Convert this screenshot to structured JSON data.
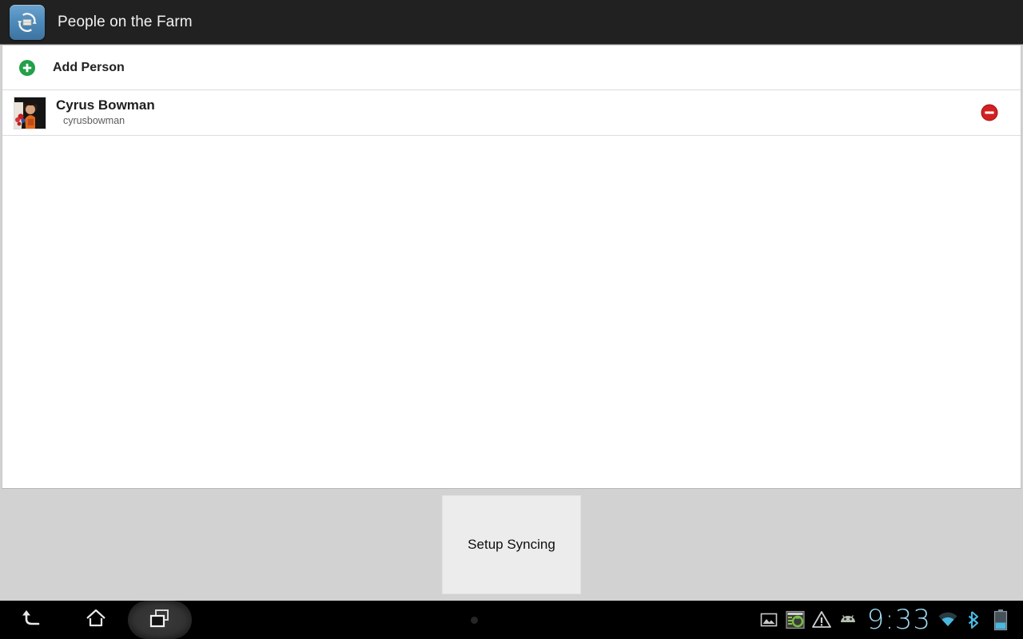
{
  "action_bar": {
    "app_icon_name": "sync-app-icon",
    "title": "People on the Farm"
  },
  "list": {
    "add_row": {
      "icon": "add-circle-icon",
      "label": "Add Person",
      "icon_color": "#22a04a"
    },
    "people": [
      {
        "avatar": "person-photo-avatar",
        "name": "Cyrus Bowman",
        "handle": "cyrusbowman",
        "remove_icon": "remove-circle-icon",
        "remove_color": "#d32020"
      }
    ]
  },
  "setup": {
    "button_label": "Setup Syncing"
  },
  "navbar": {
    "back_icon": "back-arrow-icon",
    "home_icon": "home-icon",
    "recents_icon": "recent-apps-icon",
    "menu_dot_icon": "menu-dot-icon",
    "status": {
      "gallery_icon": "image-icon",
      "screenshot_icon": "screenshot-sync-icon",
      "warning_icon": "warning-triangle-icon",
      "android_icon": "android-head-icon",
      "clock": "9:33",
      "wifi_icon": "wifi-icon",
      "bluetooth_icon": "bluetooth-icon",
      "battery_icon": "battery-icon",
      "clock_color": "#9fd8ef"
    }
  }
}
